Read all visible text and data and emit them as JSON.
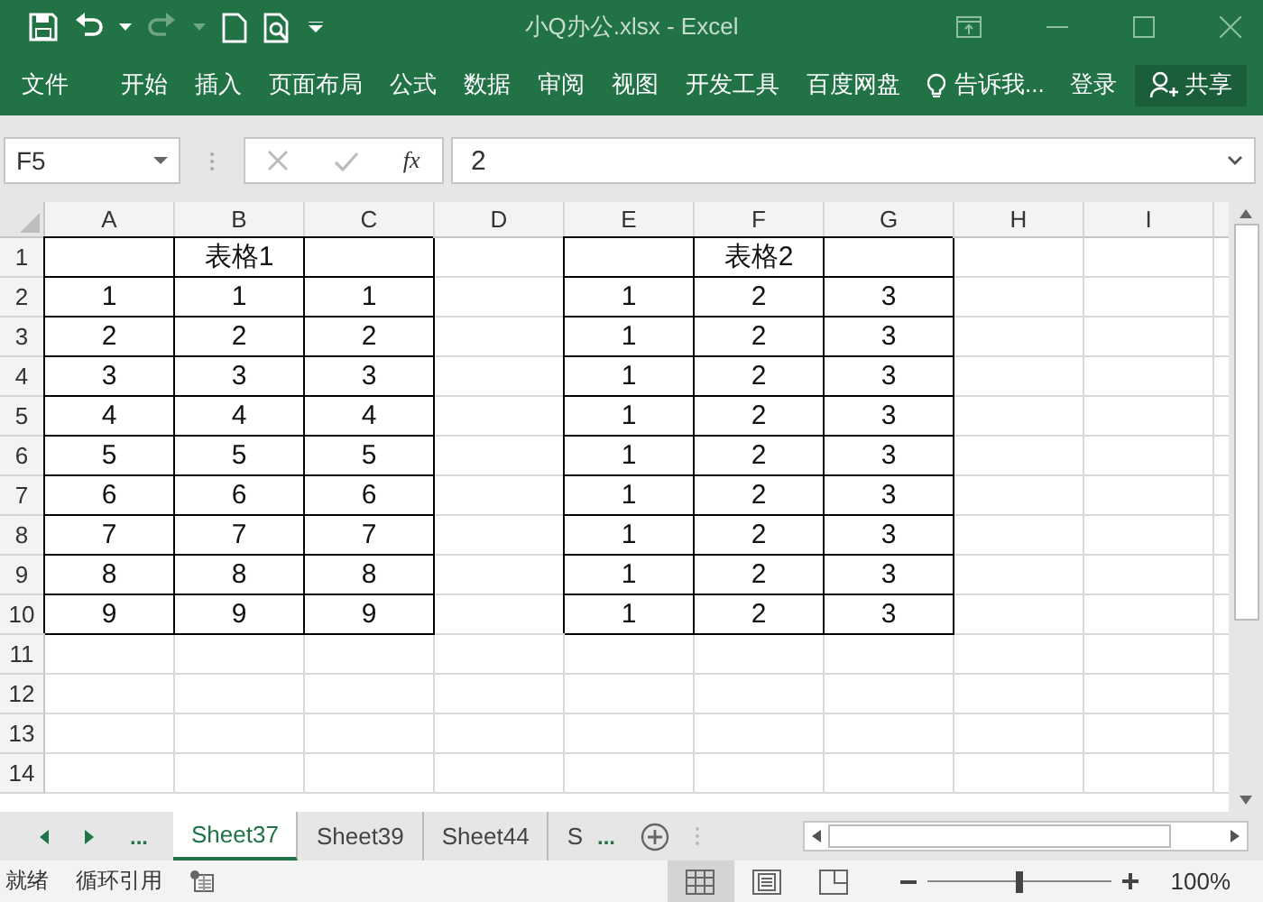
{
  "window": {
    "title": "小Q办公.xlsx - Excel"
  },
  "ribbon_tabs": [
    "文件",
    "开始",
    "插入",
    "页面布局",
    "公式",
    "数据",
    "审阅",
    "视图",
    "开发工具",
    "百度网盘"
  ],
  "tell_me": "告诉我...",
  "sign_in": "登录",
  "share": "共享",
  "name_box": "F5",
  "fx": "fx",
  "formula": "2",
  "columns": [
    "A",
    "B",
    "C",
    "D",
    "E",
    "F",
    "G",
    "H",
    "I"
  ],
  "rows": [
    "1",
    "2",
    "3",
    "4",
    "5",
    "6",
    "7",
    "8",
    "9",
    "10",
    "11",
    "12",
    "13",
    "14"
  ],
  "tables": [
    {
      "title": "表格1",
      "rows": [
        [
          "1",
          "1",
          "1"
        ],
        [
          "2",
          "2",
          "2"
        ],
        [
          "3",
          "3",
          "3"
        ],
        [
          "4",
          "4",
          "4"
        ],
        [
          "5",
          "5",
          "5"
        ],
        [
          "6",
          "6",
          "6"
        ],
        [
          "7",
          "7",
          "7"
        ],
        [
          "8",
          "8",
          "8"
        ],
        [
          "9",
          "9",
          "9"
        ]
      ]
    },
    {
      "title": "表格2",
      "rows": [
        [
          "1",
          "2",
          "3"
        ],
        [
          "1",
          "2",
          "3"
        ],
        [
          "1",
          "2",
          "3"
        ],
        [
          "1",
          "2",
          "3"
        ],
        [
          "1",
          "2",
          "3"
        ],
        [
          "1",
          "2",
          "3"
        ],
        [
          "1",
          "2",
          "3"
        ],
        [
          "1",
          "2",
          "3"
        ],
        [
          "1",
          "2",
          "3"
        ]
      ]
    }
  ],
  "nav_more": "...",
  "sheet_tabs": [
    {
      "label": "Sheet37",
      "selected": true
    },
    {
      "label": "Sheet39",
      "selected": false
    },
    {
      "label": "Sheet44",
      "selected": false
    },
    {
      "label": "S",
      "selected": false
    }
  ],
  "tabs_more": "...",
  "status": {
    "ready": "就绪",
    "circular": "循环引用",
    "views": [
      {
        "kind": "normal",
        "selected": true
      },
      {
        "kind": "page_layout",
        "selected": false
      },
      {
        "kind": "page_break",
        "selected": false
      }
    ],
    "zoom": {
      "level": 0.5,
      "reading": "100%"
    }
  }
}
